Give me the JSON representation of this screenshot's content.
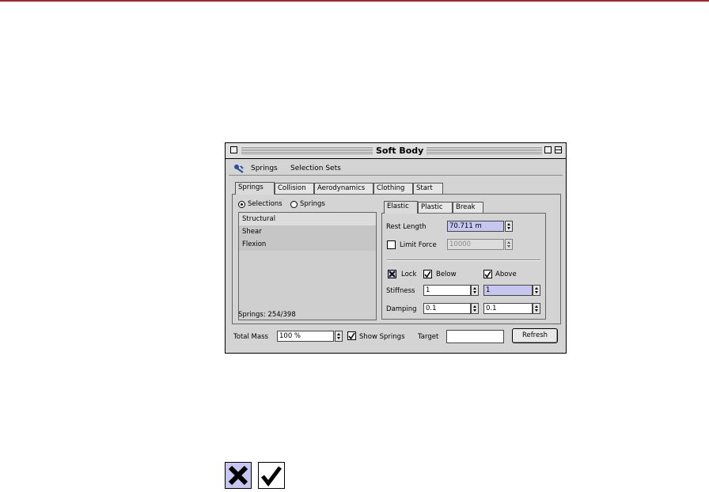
{
  "window": {
    "title": "Soft Body"
  },
  "menu": {
    "springs": "Springs",
    "selection_sets": "Selection Sets"
  },
  "tabs": [
    {
      "label": "Springs"
    },
    {
      "label": "Collision"
    },
    {
      "label": "Aerodynamics"
    },
    {
      "label": "Clothing"
    },
    {
      "label": "Start"
    }
  ],
  "selection_mode": {
    "selections_label": "Selections",
    "springs_label": "Springs",
    "selected": "Selections"
  },
  "spring_list": [
    {
      "label": "Structural"
    },
    {
      "label": "Shear"
    },
    {
      "label": "Flexion"
    }
  ],
  "springs_count": "Springs: 254/398",
  "subtabs": [
    {
      "label": "Elastic"
    },
    {
      "label": "Plastic"
    },
    {
      "label": "Break"
    }
  ],
  "elastic": {
    "rest_length_label": "Rest Length",
    "rest_length_value": "70.711 m",
    "limit_force_label": "Limit Force",
    "limit_force_value": "10000",
    "limit_force_checked": false,
    "lock_label": "Lock",
    "lock_checked": true,
    "below_label": "Below",
    "below_checked": true,
    "above_label": "Above",
    "above_checked": true,
    "stiffness_label": "Stiffness",
    "stiffness_below": "1",
    "stiffness_above": "1",
    "damping_label": "Damping",
    "damping_below": "0.1",
    "damping_above": "0.1"
  },
  "footer": {
    "total_mass_label": "Total Mass",
    "total_mass_value": "100 %",
    "show_springs_label": "Show Springs",
    "show_springs_checked": true,
    "target_label": "Target",
    "target_value": "",
    "refresh_label": "Refresh"
  },
  "colors": {
    "accent_line": "#9b2a2a",
    "highlight": "#c6c6f0"
  }
}
